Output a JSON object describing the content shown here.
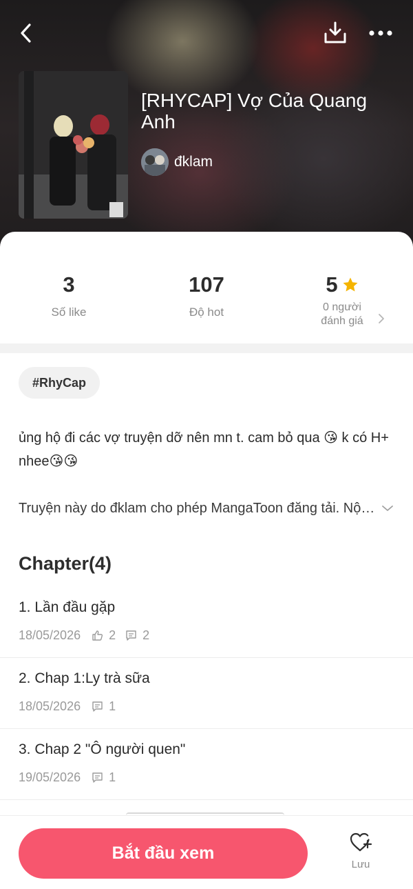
{
  "header": {
    "title": "[RHYCAP] Vợ Của Quang Anh",
    "author": "đklam"
  },
  "stats": {
    "likes": {
      "value": "3",
      "label": "Số like"
    },
    "hot": {
      "value": "107",
      "label": "Độ hot"
    },
    "rating": {
      "value": "5",
      "label": "0 người\nđánh giá"
    }
  },
  "tag": "#RhyCap",
  "description": "ủng hộ đi các vợ truyện dỡ nên mn t. cam bỏ qua 😘 k có H+ nhee😘😘",
  "notice": "Truyện này do đklam cho phép MangaToon đăng tải. Nội dung chỉ thể hiện quan điểm của tác giả.",
  "chapter_heading": "Chapter(4)",
  "chapters": [
    {
      "title": "1. Lần đầu gặp",
      "date": "18/05/2026",
      "likes": "2",
      "comments": "2"
    },
    {
      "title": "2. Chap 1:Ly trà sữa",
      "date": "18/05/2026",
      "comments": "1"
    },
    {
      "title": "3. Chap 2 \"Ô người quen\"",
      "date": "19/05/2026",
      "comments": "1"
    }
  ],
  "bottom": {
    "start_label": "Bắt đầu xem",
    "save_label": "Lưu"
  },
  "colors": {
    "accent": "#f7566e",
    "star": "#f5b400"
  },
  "icons": [
    "back-arrow-icon",
    "download-icon",
    "more-icon",
    "star-icon",
    "chevron-right-icon",
    "chevron-down-icon",
    "thumbs-up-icon",
    "comment-icon",
    "heart-plus-icon"
  ]
}
